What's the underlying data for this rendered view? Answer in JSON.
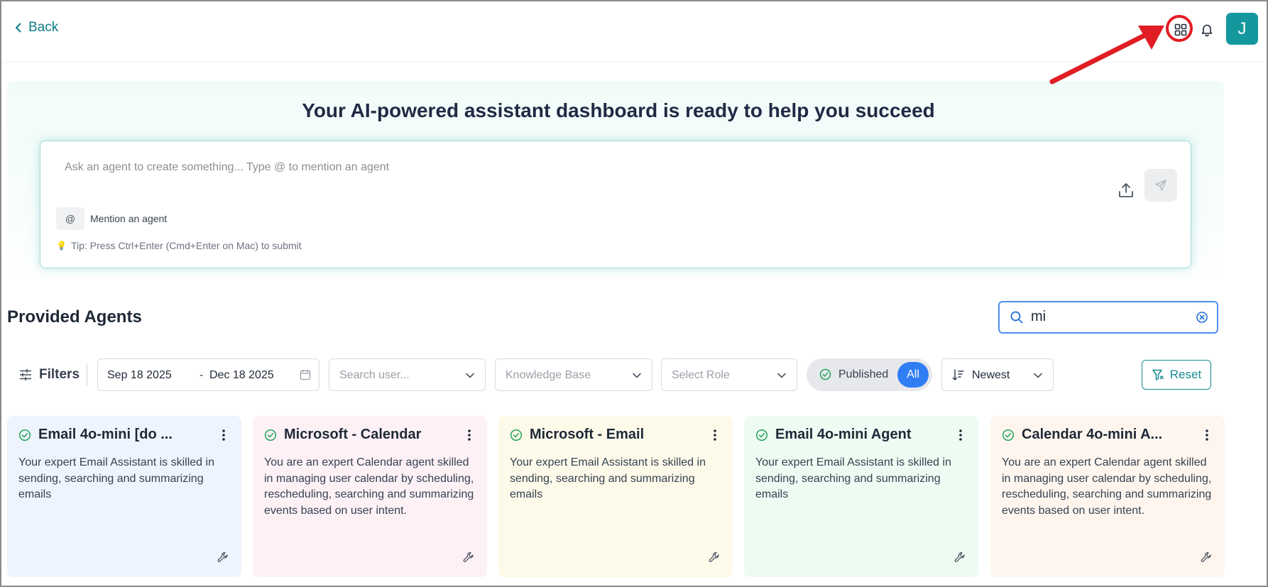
{
  "header": {
    "back_label": "Back",
    "avatar_initial": "J",
    "annotation_color": "#e11d24"
  },
  "hero": {
    "title": "Your AI-powered assistant dashboard is ready to help you succeed",
    "prompt_placeholder": "Ask an agent to create something... Type @ to mention an agent",
    "at_symbol": "@",
    "mention_label": "Mention an agent",
    "tip": "Tip: Press Ctrl+Enter (Cmd+Enter on Mac) to submit",
    "tip_icon": "💡"
  },
  "agents": {
    "section_title": "Provided Agents",
    "search_value": "mi"
  },
  "filters": {
    "label": "Filters",
    "date_start": "Sep 18 2025",
    "date_sep": "-",
    "date_end": "Dec 18 2025",
    "user_placeholder": "Search user...",
    "kb_placeholder": "Knowledge Base",
    "role_placeholder": "Select Role",
    "published_label": "Published",
    "all_label": "All",
    "sort_label": "Newest",
    "reset_label": "Reset"
  },
  "cards": [
    {
      "title": "Email 4o-mini [do ...",
      "desc": "Your expert Email Assistant is skilled in sending, searching and summarizing emails",
      "bg": "#eef4fd"
    },
    {
      "title": "Microsoft - Calendar",
      "desc": "You are an expert Calendar agent skilled in managing user calendar by scheduling, rescheduling, searching and summarizing events based on user intent.",
      "bg": "#fdf1f6"
    },
    {
      "title": "Microsoft - Email",
      "desc": "Your expert Email Assistant is skilled in sending, searching and summarizing emails",
      "bg": "#fefaea"
    },
    {
      "title": "Email 4o-mini Agent",
      "desc": "Your expert Email Assistant is skilled in sending, searching and summarizing emails",
      "bg": "#eefbf3"
    },
    {
      "title": "Calendar 4o-mini A...",
      "desc": "You are an expert Calendar agent skilled in managing user calendar by scheduling, rescheduling, searching and summarizing events based on user intent.",
      "bg": "#fef6ee"
    }
  ],
  "colors": {
    "accent": "#14989e",
    "primary_blue": "#2f7ef3",
    "published_green": "#22a55a"
  }
}
